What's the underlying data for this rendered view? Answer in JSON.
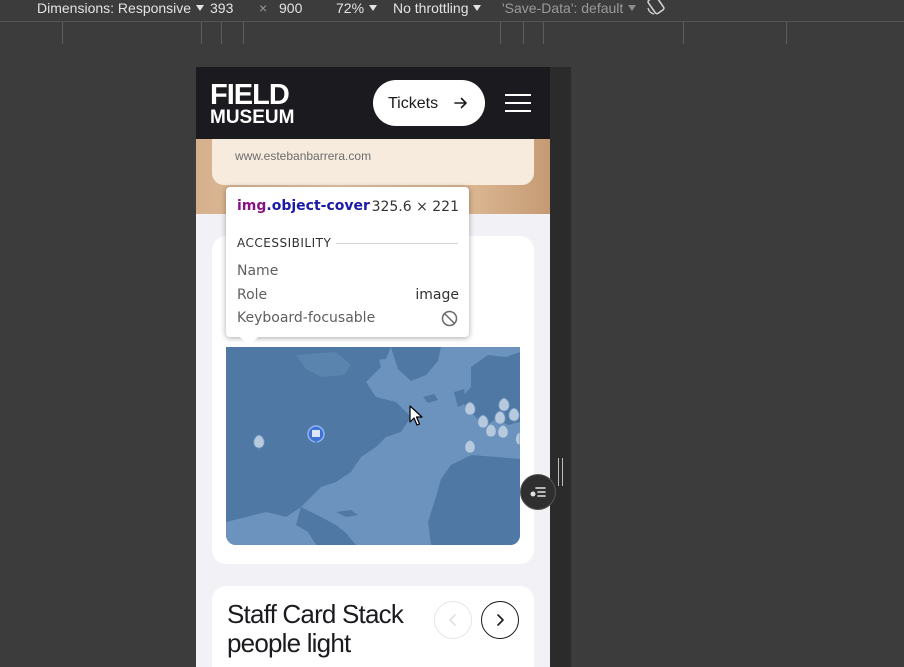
{
  "devtools": {
    "dimensions_label": "Dimensions: Responsive",
    "width_value": "393",
    "times": "×",
    "height_value": "900",
    "zoom": "72%",
    "throttling": "No throttling",
    "save_data": "'Save-Data': default"
  },
  "site": {
    "logo_line1": "FIELD",
    "logo_line2": "MUSEUM",
    "tickets_label": "Tickets",
    "image_credit": "www.estebanbarrera.com"
  },
  "tooltip": {
    "tag": "img",
    "class_name": ".object-cover",
    "size": "325.6 × 221",
    "section_title": "ACCESSIBILITY",
    "rows": [
      {
        "label": "Name",
        "value": ""
      },
      {
        "label": "Role",
        "value": "image"
      },
      {
        "label": "Keyboard-focusable",
        "value": ""
      }
    ]
  },
  "staff_card": {
    "title": "Staff Card Stack people light"
  },
  "icons": {
    "map_pin": "map-pin-icon",
    "museum_pin": "museum-pin-icon",
    "arrow": "arrow-right-icon",
    "menu": "hamburger-menu-icon",
    "not_allowed": "not-allowed-icon"
  }
}
